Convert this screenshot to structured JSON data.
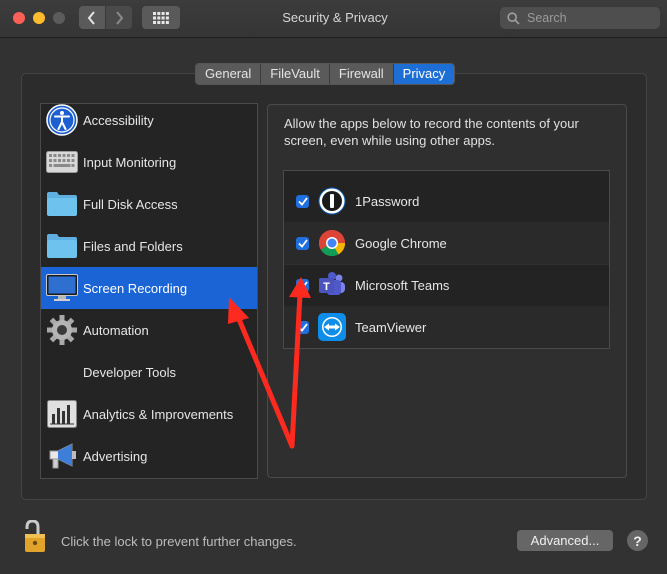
{
  "window": {
    "title": "Security & Privacy"
  },
  "search": {
    "placeholder": "Search"
  },
  "tabs": [
    {
      "label": "General",
      "active": false
    },
    {
      "label": "FileVault",
      "active": false
    },
    {
      "label": "Firewall",
      "active": false
    },
    {
      "label": "Privacy",
      "active": true
    }
  ],
  "sidebar": {
    "items": [
      {
        "label": "Accessibility",
        "icon": "accessibility-icon"
      },
      {
        "label": "Input Monitoring",
        "icon": "keyboard-icon"
      },
      {
        "label": "Full Disk Access",
        "icon": "folder-icon"
      },
      {
        "label": "Files and Folders",
        "icon": "folder-icon"
      },
      {
        "label": "Screen Recording",
        "icon": "display-icon",
        "selected": true
      },
      {
        "label": "Automation",
        "icon": "gear-icon"
      },
      {
        "label": "Developer Tools",
        "icon": ""
      },
      {
        "label": "Analytics & Improvements",
        "icon": "bar-chart-icon"
      },
      {
        "label": "Advertising",
        "icon": "megaphone-icon"
      }
    ]
  },
  "panel": {
    "description": "Allow the apps below to record the contents of your screen, even while using other apps.",
    "apps": [
      {
        "name": "1Password",
        "checked": true,
        "icon": "onepassword-icon"
      },
      {
        "name": "Google Chrome",
        "checked": true,
        "icon": "chrome-icon"
      },
      {
        "name": "Microsoft Teams",
        "checked": true,
        "icon": "teams-icon"
      },
      {
        "name": "TeamViewer",
        "checked": true,
        "icon": "teamviewer-icon"
      }
    ]
  },
  "footer": {
    "lock_text": "Click the lock to prevent further changes.",
    "advanced_label": "Advanced...",
    "help_label": "?"
  },
  "colors": {
    "accent": "#1a64d6",
    "annotation": "#ff2a1f"
  }
}
